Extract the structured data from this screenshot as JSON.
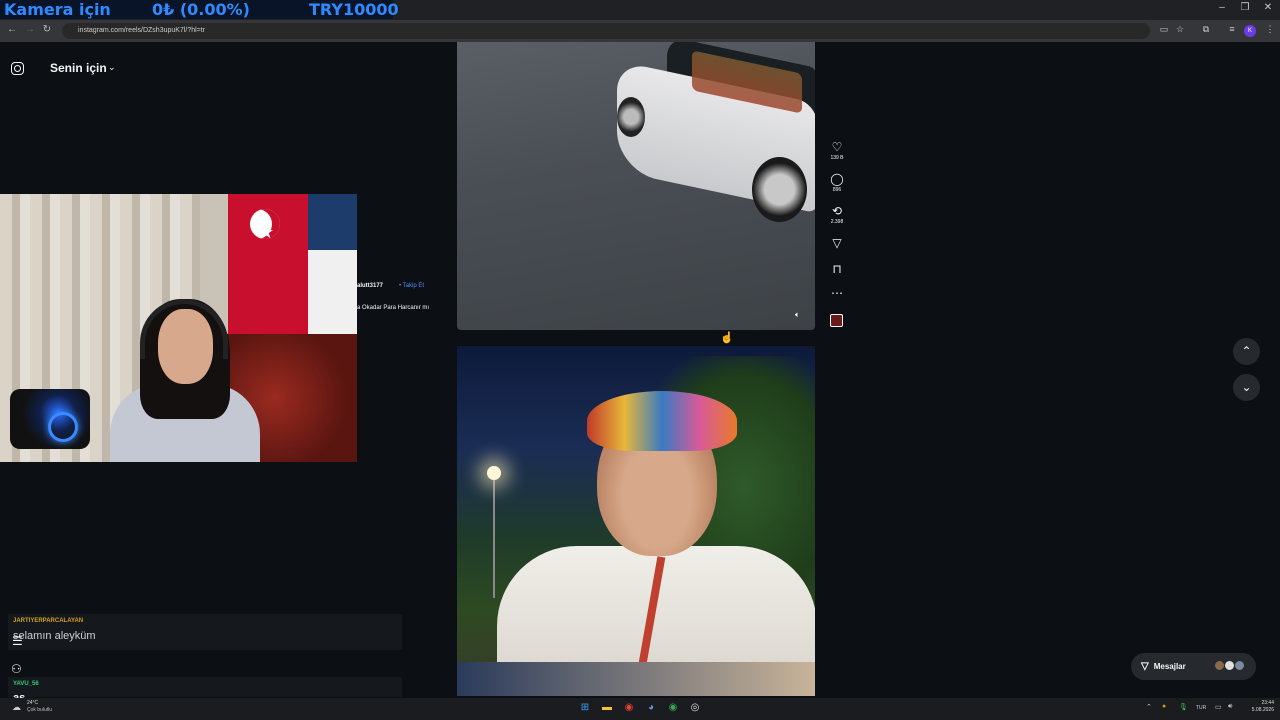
{
  "overlay": {
    "label": "Kamera için",
    "amount": "0₺ (0.00%)",
    "goal": "TRY10000"
  },
  "browser": {
    "url": "instagram.com/reels/DZsh3upuK7l/?hl=tr",
    "profile_initial": "K"
  },
  "instagram": {
    "feed_title": "Senin için",
    "actions": {
      "likes": "139 B",
      "comments": "896",
      "reposts": "2.398"
    },
    "peek_username": "alutt3177",
    "peek_follow": "• Takip Et",
    "peek_caption": "a Okadar Para Harcanır mı",
    "messages_label": "Mesajlar"
  },
  "chat": [
    {
      "user": "JARTIYERPARCALAYAN",
      "message": "selamın aleyküm"
    },
    {
      "user": "YAVU_56",
      "message": "as"
    }
  ],
  "taskbar": {
    "weather_temp": "24°C",
    "weather_text": "Çok bulutlu",
    "language": "TUR",
    "time": "23:44",
    "date": "5.08.2026"
  },
  "colors": {
    "accent_blue": "#2e8bff",
    "ig_background": "#0c1014",
    "follow_blue": "#4f8df8",
    "chat_user1": "#d4a017",
    "chat_user2": "#2ecc71"
  }
}
